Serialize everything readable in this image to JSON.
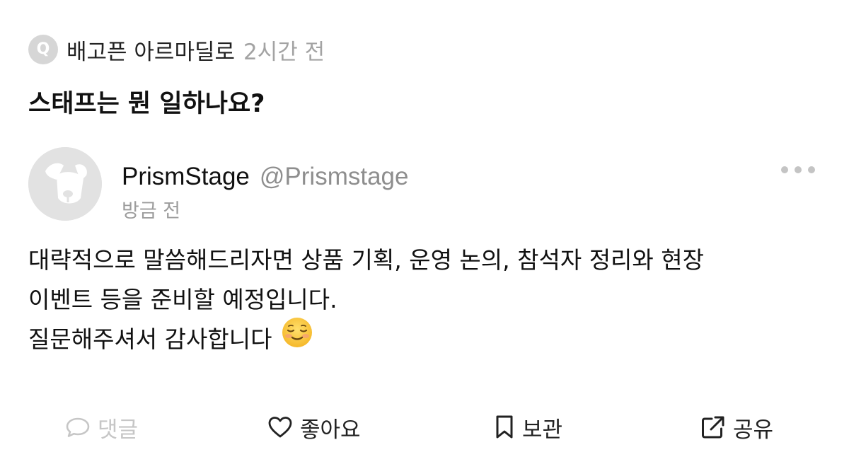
{
  "question": {
    "badge": "Q",
    "asker": "배고픈 아르마딜로",
    "time": "2시간 전",
    "text": "스태프는 뭔 일하나요?"
  },
  "answer": {
    "author_name": "PrismStage",
    "author_handle": "@Prismstage",
    "time": "방금 전",
    "lines": [
      "대략적으로 말씀해드리자면 상품 기획, 운영 논의, 참석자 정리와 현장",
      "이벤트 등을 준비할 예정입니다.",
      "질문해주셔서 감사합니다"
    ],
    "emoji": "smiling-face-emoji"
  },
  "actions": {
    "comment": {
      "label": "댓글",
      "icon": "speech-bubble-icon",
      "enabled": false
    },
    "like": {
      "label": "좋아요",
      "icon": "heart-icon"
    },
    "save": {
      "label": "보관",
      "icon": "bookmark-icon"
    },
    "share": {
      "label": "공유",
      "icon": "share-icon"
    }
  },
  "colors": {
    "text": "#111111",
    "muted": "#a3a3a3",
    "disabled": "#c6c6c6",
    "badge": "#d6d6d6",
    "avatar_bg": "#e2e2e2"
  }
}
